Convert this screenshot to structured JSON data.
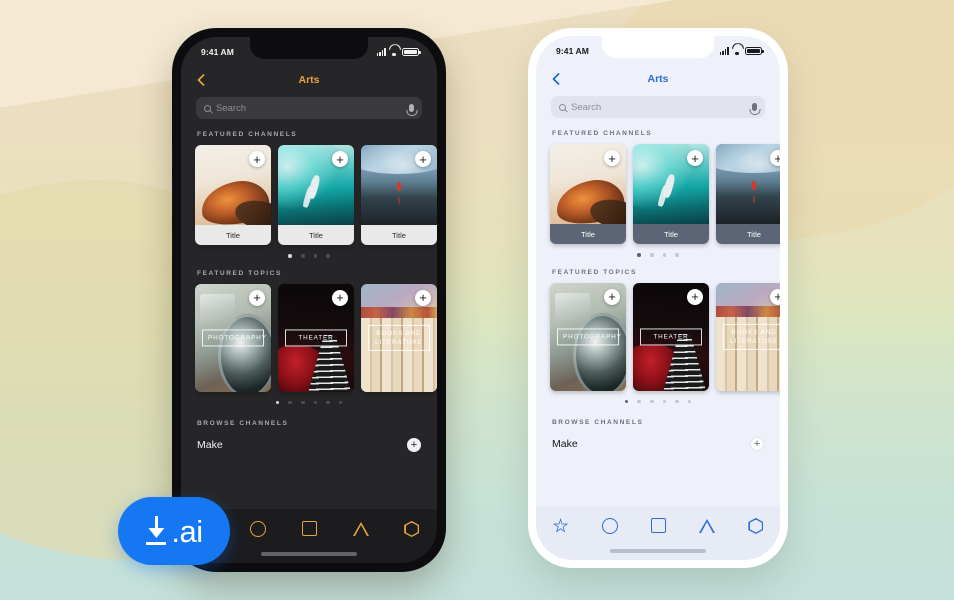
{
  "background": {
    "top_color": "#f4ead4",
    "mid_color": "#e6e2bd",
    "bottom_color": "#c3e0da"
  },
  "badge": {
    "label": ".ai",
    "icon": "download-icon",
    "color": "#1578f2"
  },
  "phones": [
    {
      "id": "dark",
      "theme": "dark",
      "frame_color": "#0d0d0f",
      "screen_bg": "#262628",
      "accent": "#e8a33d",
      "status": {
        "time": "9:41 AM",
        "signal_icon": "cellular-signal-icon",
        "wifi_icon": "wifi-icon",
        "battery_icon": "battery-icon"
      },
      "nav": {
        "back_icon": "chevron-left-icon",
        "title": "Arts"
      },
      "search": {
        "icon": "search-icon",
        "placeholder": "Search",
        "mic_icon": "microphone-icon"
      },
      "featured_channels": {
        "heading": "FEATURED CHANNELS",
        "cards": [
          {
            "caption": "Title",
            "art": "turtle",
            "add_label": "+"
          },
          {
            "caption": "Title",
            "art": "surf",
            "add_label": "+"
          },
          {
            "caption": "Title",
            "art": "cliff",
            "add_label": "+"
          }
        ],
        "dots": 4,
        "active_dot": 0
      },
      "featured_topics": {
        "heading": "FEATURED TOPICS",
        "cards": [
          {
            "label": "PHOTOGRAPHY",
            "art": "camera",
            "add_label": "+"
          },
          {
            "label": "THEATER",
            "art": "theater",
            "add_label": "+"
          },
          {
            "label": "BOOKS AND\nLITERATURE",
            "art": "books",
            "add_label": "+"
          }
        ],
        "dots": 6,
        "active_dot": 0
      },
      "browse": {
        "heading": "BROWSE CHANNELS",
        "item_label": "Make",
        "add_label": "+"
      },
      "tabs": [
        {
          "icon": "star-icon",
          "name": "tab-favorites"
        },
        {
          "icon": "circle-icon",
          "name": "tab-circle"
        },
        {
          "icon": "square-icon",
          "name": "tab-square"
        },
        {
          "icon": "triangle-icon",
          "name": "tab-triangle"
        },
        {
          "icon": "hexagon-icon",
          "name": "tab-hexagon"
        }
      ]
    },
    {
      "id": "light",
      "theme": "light",
      "frame_color": "#ffffff",
      "screen_bg": "#eef1f9",
      "accent": "#2a6dd6",
      "status": {
        "time": "9:41 AM",
        "signal_icon": "cellular-signal-icon",
        "wifi_icon": "wifi-icon",
        "battery_icon": "battery-icon"
      },
      "nav": {
        "back_icon": "chevron-left-icon",
        "title": "Arts"
      },
      "search": {
        "icon": "search-icon",
        "placeholder": "Search",
        "mic_icon": "microphone-icon"
      },
      "featured_channels": {
        "heading": "FEATURED CHANNELS",
        "cards": [
          {
            "caption": "Title",
            "art": "turtle",
            "add_label": "+"
          },
          {
            "caption": "Title",
            "art": "surf",
            "add_label": "+"
          },
          {
            "caption": "Title",
            "art": "cliff",
            "add_label": "+"
          }
        ],
        "dots": 4,
        "active_dot": 0
      },
      "featured_topics": {
        "heading": "FEATURED TOPICS",
        "cards": [
          {
            "label": "PHOTOGRAPHY",
            "art": "camera",
            "add_label": "+"
          },
          {
            "label": "THEATER",
            "art": "theater",
            "add_label": "+"
          },
          {
            "label": "BOOKS AND\nLITERATURE",
            "art": "books",
            "add_label": "+"
          }
        ],
        "dots": 6,
        "active_dot": 0
      },
      "browse": {
        "heading": "BROWSE CHANNELS",
        "item_label": "Make",
        "add_label": "+"
      },
      "tabs": [
        {
          "icon": "star-icon",
          "name": "tab-favorites"
        },
        {
          "icon": "circle-icon",
          "name": "tab-circle"
        },
        {
          "icon": "square-icon",
          "name": "tab-square"
        },
        {
          "icon": "triangle-icon",
          "name": "tab-triangle"
        },
        {
          "icon": "hexagon-icon",
          "name": "tab-hexagon"
        }
      ]
    }
  ]
}
